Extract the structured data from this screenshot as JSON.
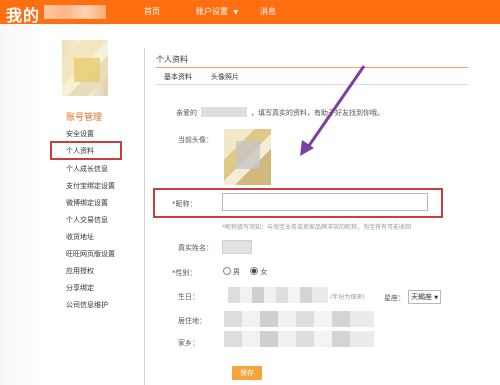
{
  "header": {
    "logo": "我的",
    "nav": {
      "home": "首页",
      "settings": "账户设置",
      "news": "消息"
    }
  },
  "sidebar": {
    "title": "账号管理",
    "items": [
      {
        "label": "安全设置"
      },
      {
        "label": "个人资料"
      },
      {
        "label": "个人成长信息"
      },
      {
        "label": "支付宝绑定设置"
      },
      {
        "label": "微博绑定设置"
      },
      {
        "label": "个人交易信息"
      },
      {
        "label": "收货地址"
      },
      {
        "label": "旺旺网页版设置"
      },
      {
        "label": "应用授权"
      },
      {
        "label": "分享绑定"
      },
      {
        "label": "公司信息维护"
      }
    ]
  },
  "main": {
    "section_title": "个人资料",
    "tabs": [
      {
        "label": "基本资料"
      },
      {
        "label": "头像照片"
      }
    ],
    "greeting_prefix": "亲爱的",
    "greeting_suffix": "，填写真实的资料，有助于好友找到你哦。",
    "current_avatar_label": "当前头像：",
    "nickname": {
      "label": "昵称：",
      "required": "*",
      "value": "",
      "hint": "*昵称填写须知：与淘宝业务或卖家品牌冲突的昵称，淘宝将有可能收回"
    },
    "real_name_label": "真实姓名：",
    "gender": {
      "required": "*",
      "label": "性别：",
      "male": "男",
      "female": "女",
      "selected": "女"
    },
    "birthday_label": "生日：",
    "birthday_note": "(年份为保密)",
    "constellation_label": "星座：",
    "constellation_value": "天蝎座",
    "residence_label": "居住地：",
    "hometown_label": "家乡：",
    "save_label": "保存"
  },
  "colors": {
    "brand": "#ff6f12",
    "highlight_border": "#c43f3f",
    "arrow": "#7b3fa0"
  }
}
